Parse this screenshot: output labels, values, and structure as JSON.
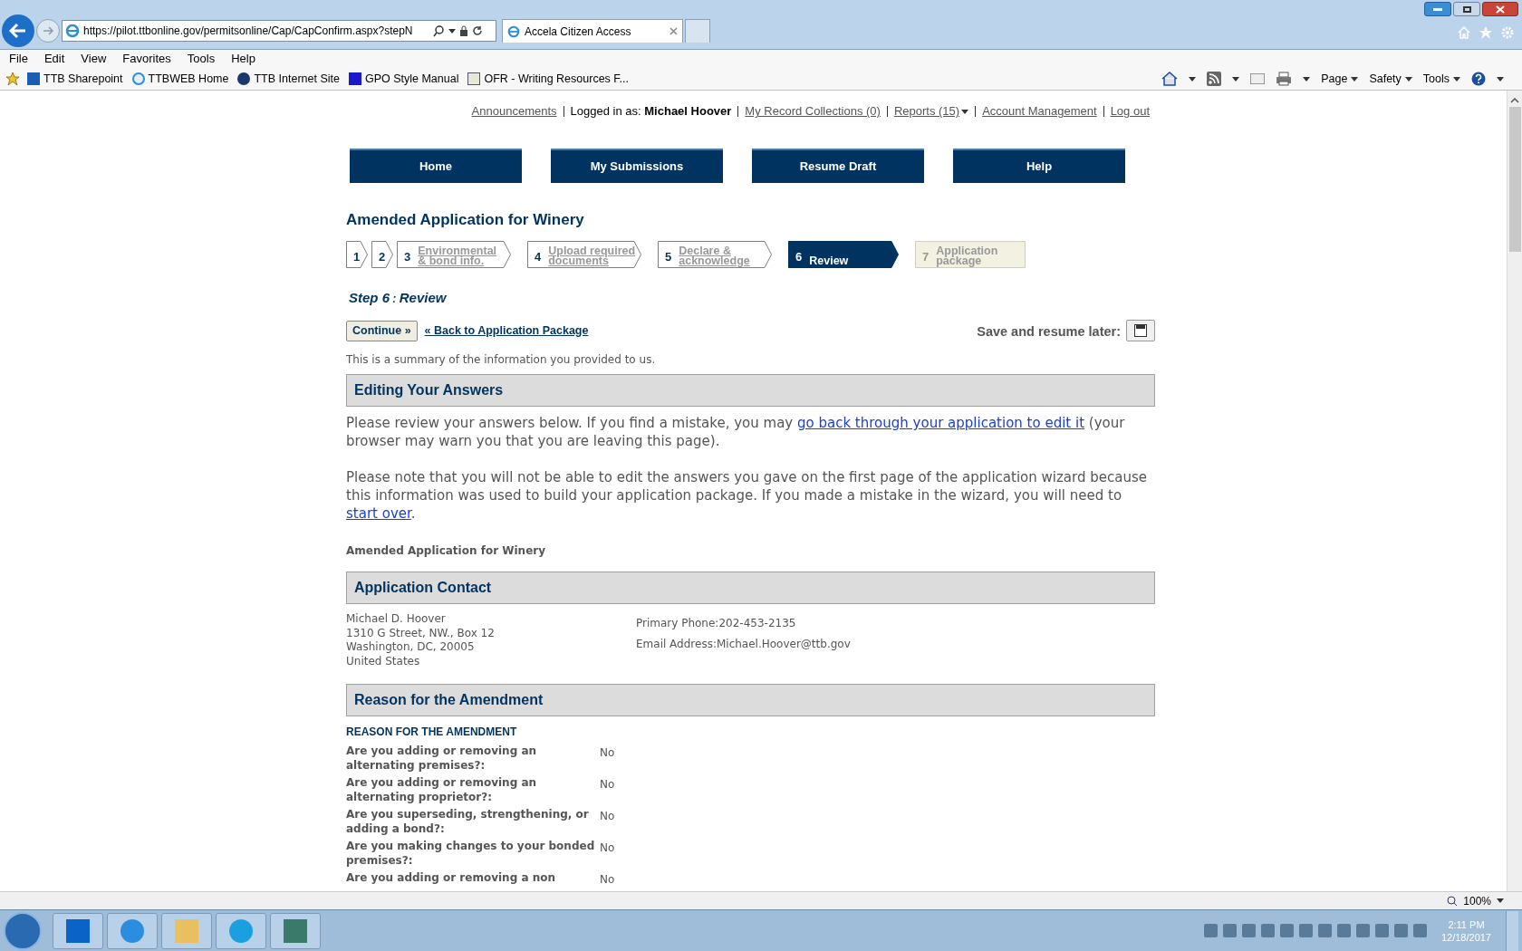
{
  "browser": {
    "url": "https://pilot.ttbonline.gov/permitsonline/Cap/CapConfirm.aspx?stepN",
    "tabs": [
      {
        "title": "Accela Citizen Access",
        "selected": true
      }
    ],
    "menu": [
      "File",
      "Edit",
      "View",
      "Favorites",
      "Tools",
      "Help"
    ],
    "favorites": [
      "TTB Sharepoint",
      "TTBWEB Home",
      "TTB Internet Site",
      "GPO Style Manual",
      "OFR - Writing Resources F..."
    ],
    "commands": [
      "Page",
      "Safety",
      "Tools"
    ],
    "zoom": "100%"
  },
  "top_links": [
    {
      "kind": "link",
      "text": "Announcements"
    },
    {
      "kind": "user",
      "label": "Logged in as:",
      "name": "Michael Hoover"
    },
    {
      "kind": "link",
      "text": "My Record Collections (0)"
    },
    {
      "kind": "menu",
      "text": "Reports (15)"
    },
    {
      "kind": "link",
      "text": "Account Management"
    },
    {
      "kind": "link",
      "text": "Log out"
    }
  ],
  "nav": [
    "Home",
    "My Submissions",
    "Resume Draft",
    "Help"
  ],
  "page_title": "Amended Application for Winery",
  "steps": [
    {
      "number": "1",
      "selected": false,
      "disabled": false
    },
    {
      "number": "2",
      "selected": false,
      "disabled": false
    },
    {
      "number": "3",
      "label": "Environmental & bond info.",
      "selected": false,
      "disabled": false
    },
    {
      "number": "4",
      "label": "Upload required documents",
      "selected": false,
      "disabled": false
    },
    {
      "number": "5",
      "label": "Declare & acknowledge",
      "selected": false,
      "disabled": false
    },
    {
      "number": "6",
      "label": "Review",
      "selected": true,
      "disabled": false
    },
    {
      "number": "7",
      "label": "Application package",
      "selected": false,
      "disabled": true
    }
  ],
  "step_heading": {
    "step": "Step 6",
    "separator": ":",
    "name": "Review"
  },
  "continue_button": "Continue »",
  "back_link": "« Back to Application Package",
  "save_label": "Save and resume later:",
  "summary": "This is a summary of the information you provided to us.",
  "editing": {
    "title": "Editing Your Answers",
    "p1_before": "Please review your answers below. If you find a mistake, you may",
    "p1_link": "go back through your application to edit it",
    "p1_after": "(your browser may warn you that you are leaving this page).",
    "p2_before": "Please note that you will not be able to edit the answers you gave on the first page of the application wizard because this information was used to build your application package. If you made a mistake in the wizard, you will need to",
    "p2_link": "start over",
    "p2_after": "."
  },
  "record_type": "Amended Application for Winery",
  "contact": {
    "title": "Application Contact",
    "address": [
      "Michael D. Hoover",
      "1310 G Street, NW., Box 12",
      "Washington, DC, 20005",
      "United States"
    ],
    "phone_label": "Primary Phone:",
    "phone": "202-453-2135",
    "email_label": "Email Address:",
    "email": "Michael.Hoover@ttb.gov"
  },
  "amendment": {
    "title": "Reason for the Amendment",
    "subtitle": "REASON FOR THE AMENDMENT",
    "rows": [
      {
        "question": "Are you adding or removing an alternating premises?:",
        "answer": "No"
      },
      {
        "question": "Are you adding or removing an alternating proprietor?:",
        "answer": "No"
      },
      {
        "question": "Are you superseding, strengthening, or adding a bond?:",
        "answer": "No"
      },
      {
        "question": "Are you making changes to your bonded premises?:",
        "answer": "No"
      },
      {
        "question": "Are you adding or removing a non",
        "answer": "No"
      }
    ]
  },
  "taskbar": {
    "time": "2:11 PM",
    "date": "12/18/2017"
  }
}
